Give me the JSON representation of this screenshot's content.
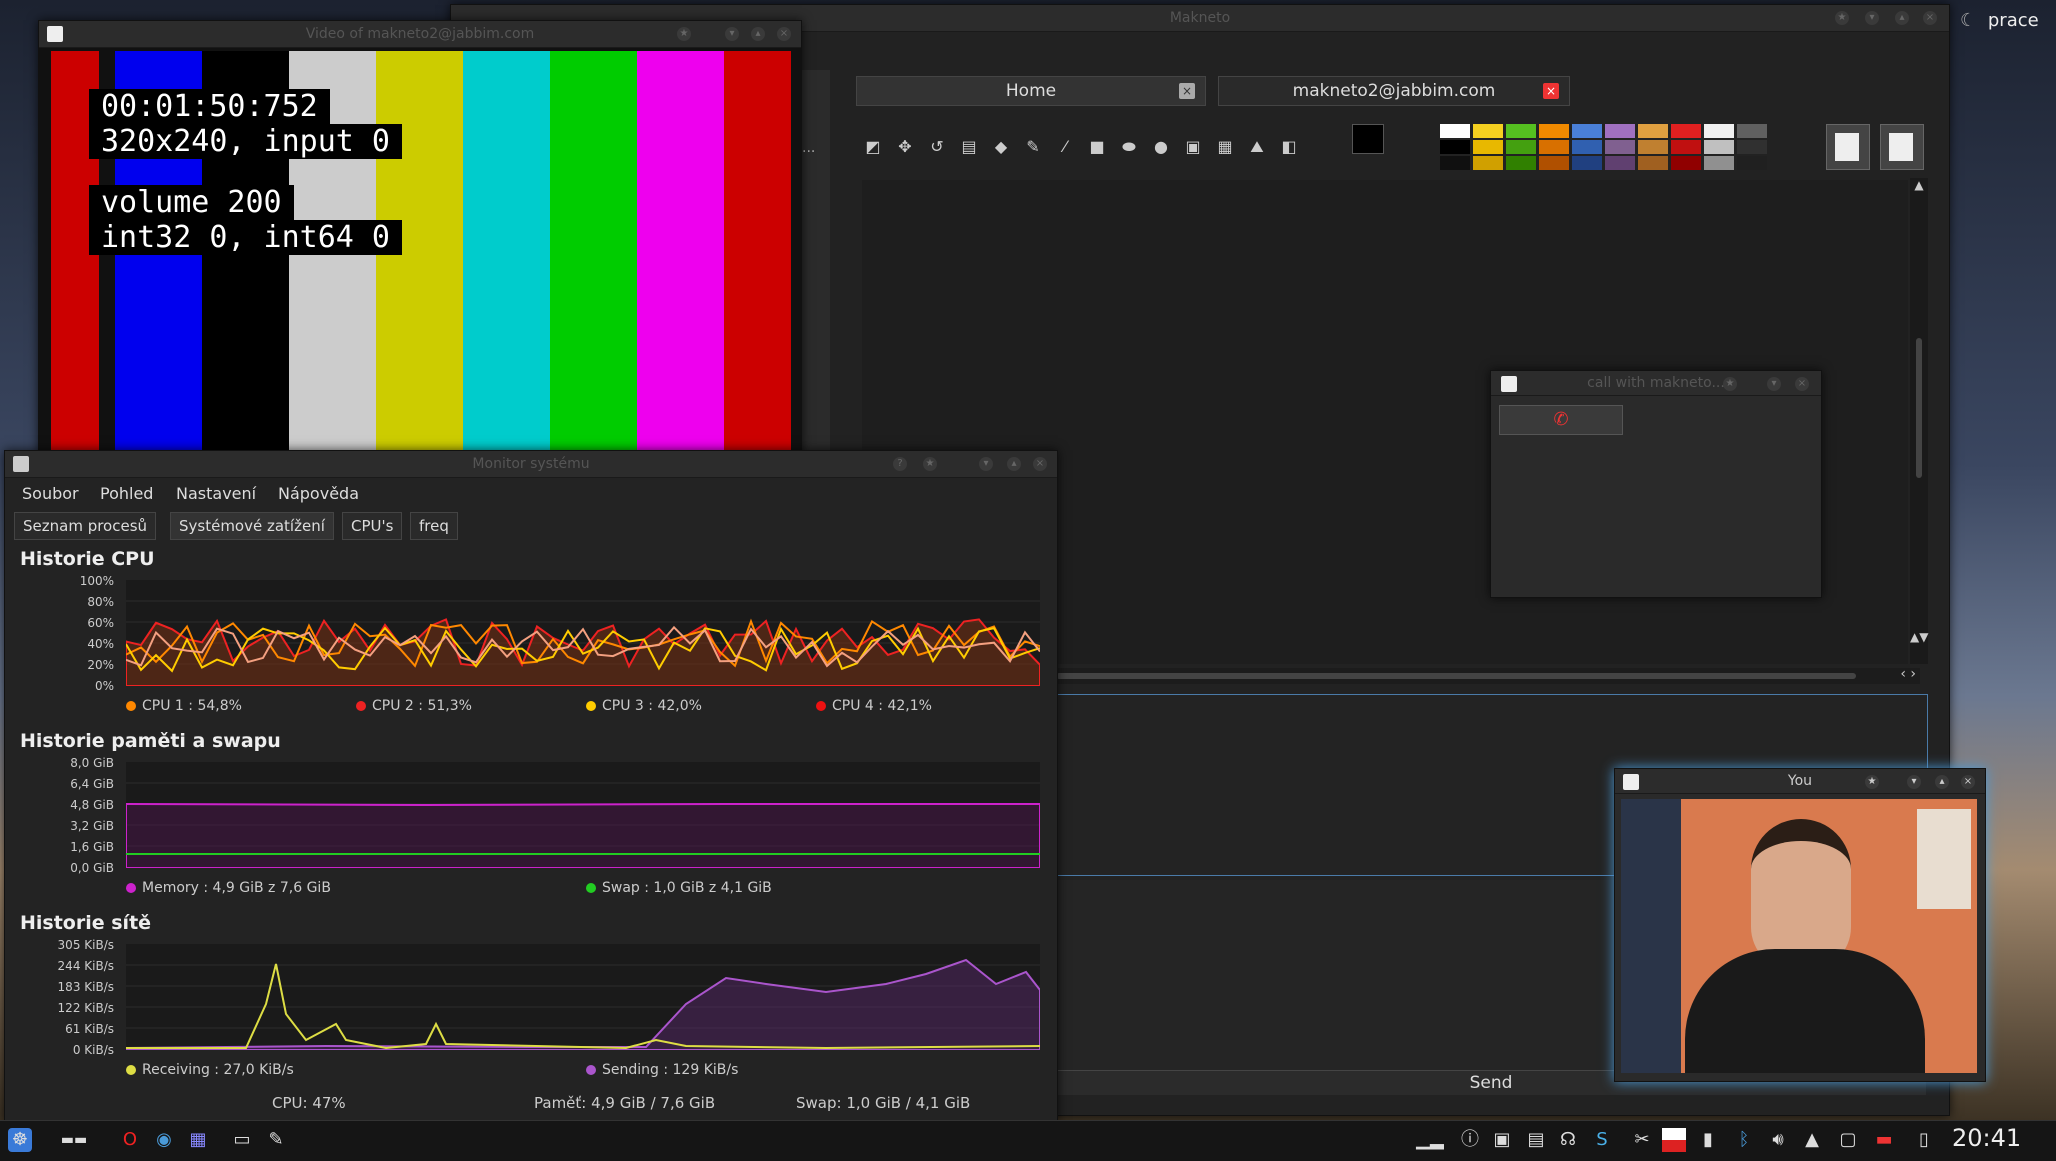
{
  "desktop": {
    "activity_label": "prace"
  },
  "makneto": {
    "title": "Makneto",
    "tabs": [
      {
        "label": "Home"
      },
      {
        "label": "makneto2@jabbim.com"
      }
    ],
    "send_label": "Send",
    "ellipsis": "..."
  },
  "video_window": {
    "title": "Video of makneto2@jabbim.com",
    "overlay_lines": [
      "00:01:50:752",
      "320x240, input 0",
      "volume 200",
      "int32 0, int64 0"
    ],
    "bar_colors": [
      "#cc0000",
      "#0000ee",
      "#000000",
      "#cccccc",
      "#cccc00",
      "#00cccc",
      "#00cc00",
      "#ee00ee",
      "#cc0000"
    ]
  },
  "call_window": {
    "title": "call with makneto..."
  },
  "you_window": {
    "title": "You"
  },
  "system_monitor": {
    "title": "Monitor systému",
    "menu": [
      "Soubor",
      "Pohled",
      "Nastavení",
      "Nápověda"
    ],
    "tabs": [
      "Seznam procesů",
      "Systémové zatížení",
      "CPU's",
      "freq"
    ],
    "cpu": {
      "heading": "Historie CPU",
      "y_ticks": [
        "100%",
        "80%",
        "60%",
        "40%",
        "20%",
        "0%"
      ],
      "legend": [
        "CPU 1 : 54,8%",
        "CPU 2 : 51,3%",
        "CPU 3 : 42,0%",
        "CPU 4 : 42,1%"
      ],
      "colors": [
        "#ff8800",
        "#ee2222",
        "#ffcc00",
        "#ee1111"
      ]
    },
    "memory": {
      "heading": "Historie paměti a swapu",
      "y_ticks": [
        "8,0 GiB",
        "6,4 GiB",
        "4,8 GiB",
        "3,2 GiB",
        "1,6 GiB",
        "0,0 GiB"
      ],
      "legend": [
        "Memory : 4,9 GiB z 7,6 GiB",
        "Swap : 1,0 GiB z 4,1 GiB"
      ],
      "colors": [
        "#cc22cc",
        "#22cc22"
      ]
    },
    "network": {
      "heading": "Historie sítě",
      "y_ticks": [
        "305 KiB/s",
        "244 KiB/s",
        "183 KiB/s",
        "122 KiB/s",
        "61 KiB/s",
        "0 KiB/s"
      ],
      "legend": [
        "Receiving : 27,0 KiB/s",
        "Sending : 129 KiB/s"
      ],
      "colors": [
        "#dddd44",
        "#aa55cc"
      ]
    },
    "status": [
      "CPU: 47%",
      "Paměť: 4,9 GiB / 7,6 GiB",
      "Swap: 1,0 GiB / 4,1 GiB"
    ]
  },
  "taskbar": {
    "clock": "20:41"
  }
}
